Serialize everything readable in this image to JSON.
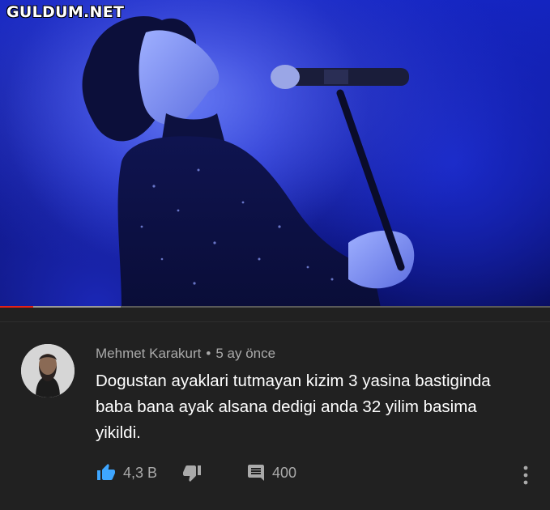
{
  "watermark": "GULDUM.NET",
  "video": {
    "progress_played": 0.06,
    "progress_buffered": 0.22
  },
  "comment": {
    "author": "Mehmet Karakurt",
    "separator": "•",
    "time": "5 ay önce",
    "text": "Dogustan ayaklari tutmayan kizim 3 yasina bastiginda baba bana ayak alsana dedigi anda 32 yilim basima yikildi.",
    "likes": "4,3 B",
    "replies": "400"
  },
  "icons": {
    "like": "thumb-up-icon",
    "dislike": "thumb-down-icon",
    "reply": "comment-icon",
    "more": "more-vertical-icon"
  },
  "colors": {
    "accent_like": "#3ea6ff",
    "progress": "#e62117",
    "background": "#212121"
  }
}
